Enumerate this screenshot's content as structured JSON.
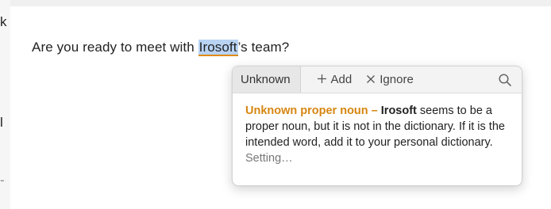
{
  "background_window": {
    "edge_chars": [
      "k",
      "l",
      "-"
    ]
  },
  "document": {
    "sentence_before": "Are you ready to meet with ",
    "flagged_word": "Irosoft",
    "sentence_after": "’s team?"
  },
  "popup": {
    "tab_label": "Unknown",
    "add_label": "Add",
    "ignore_label": "Ignore",
    "icons": {
      "add": "plus-icon",
      "ignore": "x-icon",
      "search": "search-icon"
    },
    "headline": "Unknown proper noun –",
    "term": "Irosoft",
    "message": "seems to be a proper noun, but it is not in the dictionary. If it is the intended word, add it to your personal dictionary.",
    "settings_link": "Setting…"
  },
  "colors": {
    "highlight": "#b9d3f3",
    "underline": "#e08a14",
    "headline": "#d68610"
  }
}
